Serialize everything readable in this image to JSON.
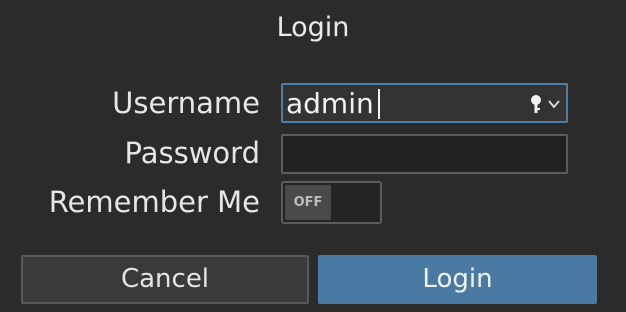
{
  "dialog": {
    "title": "Login"
  },
  "form": {
    "username_label": "Username",
    "username_value": "admin",
    "password_label": "Password",
    "password_value": "",
    "remember_label": "Remember Me",
    "remember_toggle_text": "OFF",
    "remember_enabled": false
  },
  "buttons": {
    "cancel_label": "Cancel",
    "login_label": "Login"
  },
  "icons": {
    "username_key": "key-icon",
    "username_dropdown": "chevron-down-icon"
  },
  "colors": {
    "accent": "#4a7aa4",
    "background": "#2b2b2b",
    "text": "#e8e8e8"
  }
}
